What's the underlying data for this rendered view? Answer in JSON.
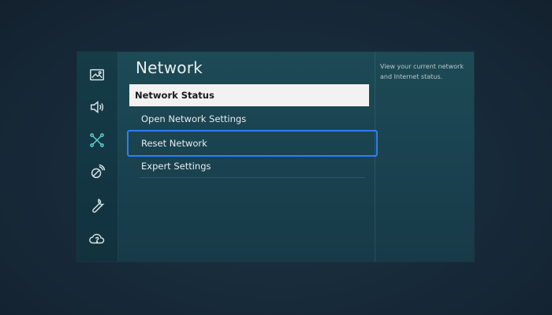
{
  "settings": {
    "title": "Network",
    "menu": [
      {
        "label": "Network Status"
      },
      {
        "label": "Open Network Settings"
      },
      {
        "label": "Reset Network"
      },
      {
        "label": "Expert Settings"
      }
    ],
    "help_text": "View your current network and Internet status."
  },
  "sidebar": {
    "icons": [
      "picture-icon",
      "sound-icon",
      "network-icon",
      "broadcasting-icon",
      "support-wrench-icon",
      "cloud-help-icon"
    ],
    "active_index": 2
  },
  "colors": {
    "selected_bg": "#f2f2f2",
    "focus_border": "#2f7ef0",
    "active_icon": "#5fd3c6"
  }
}
